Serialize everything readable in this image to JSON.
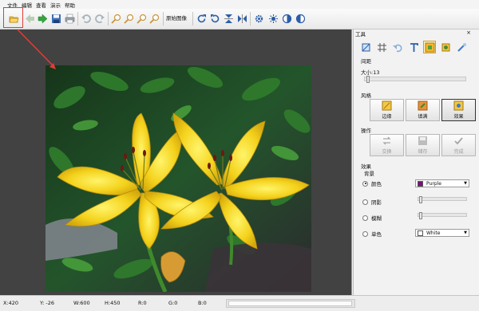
{
  "menu": [
    "文件",
    "编辑",
    "查看",
    "演示",
    "帮助"
  ],
  "toolbar": {
    "original_image_label": "原始图像"
  },
  "panel": {
    "title": "工具",
    "close": "×",
    "section_spacing": "间距",
    "size_label": "大小:13",
    "size_value": 13,
    "style_label": "风格",
    "style_buttons": [
      "边缘",
      "填满",
      "效果"
    ],
    "ops_label": "操作",
    "ops_buttons": [
      "交换",
      "储存",
      "完成"
    ],
    "effect_label": "效果",
    "background_label": "背景",
    "radios": [
      "颜色",
      "阴影",
      "模糊",
      "单色"
    ],
    "color1": {
      "name": "Purple",
      "hex": "#7a0f7c"
    },
    "color2": {
      "name": "White",
      "hex": "#ffffff"
    }
  },
  "status": {
    "x": "X:420",
    "y": "Y: -26",
    "w": "W:600",
    "h": "H:450",
    "r": "R:0",
    "g": "G:0",
    "b": "B:0"
  },
  "colors": {
    "highlight": "#e53b35",
    "canvas": "#424242",
    "active_tool": "#fff1c4"
  }
}
